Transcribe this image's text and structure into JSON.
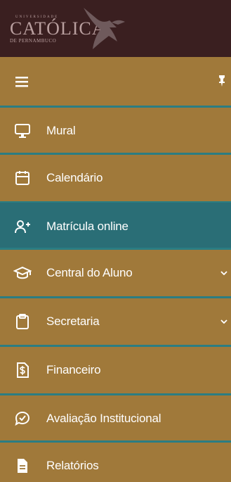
{
  "brand": {
    "university_small": "UNIVERSIDADE",
    "name": "CATÓLICA",
    "subtitle": "DE PERNAMBUCO",
    "logo_icon": "dove-icon",
    "colors": {
      "header_bg": "#3a1f20",
      "logo_text": "#b99f9f"
    }
  },
  "toolbar": {
    "menu_icon": "hamburger-icon",
    "pin_icon": "pin-icon"
  },
  "menu": {
    "items": [
      {
        "label": "Mural",
        "icon": "monitor-icon",
        "active": false,
        "has_submenu": false
      },
      {
        "label": "Calendário",
        "icon": "calendar-icon",
        "active": false,
        "has_submenu": false
      },
      {
        "label": "Matrícula online",
        "icon": "user-plus-icon",
        "active": true,
        "has_submenu": false
      },
      {
        "label": "Central do Aluno",
        "icon": "graduation-cap-icon",
        "active": false,
        "has_submenu": true
      },
      {
        "label": "Secretaria",
        "icon": "clipboard-icon",
        "active": false,
        "has_submenu": true
      },
      {
        "label": "Financeiro",
        "icon": "dollar-file-icon",
        "active": false,
        "has_submenu": false
      },
      {
        "label": "Avaliação Institucional",
        "icon": "check-chat-icon",
        "active": false,
        "has_submenu": false
      },
      {
        "label": "Relatórios",
        "icon": "document-icon",
        "active": false,
        "has_submenu": false
      }
    ]
  },
  "colors": {
    "sidebar_bg": "#a0793a",
    "active_bg": "#2a6e76",
    "separator": "#2b7d82",
    "text": "#ffffff"
  }
}
